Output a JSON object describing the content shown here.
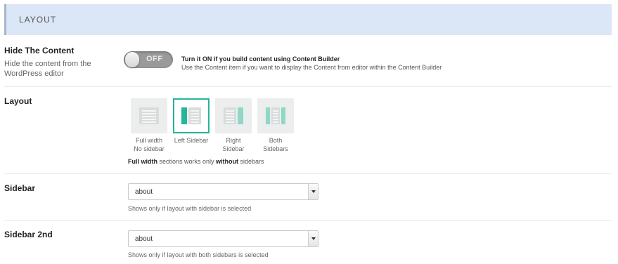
{
  "section": {
    "title": "LAYOUT"
  },
  "hide_content": {
    "title": "Hide The Content",
    "description": "Hide the content from the WordPress editor",
    "toggle_state": "OFF",
    "hint_title": "Turn it ON if you build content using Content Builder",
    "hint_sub": "Use the Content item if you want to display the Content from editor within the Content Builder"
  },
  "layout": {
    "title": "Layout",
    "options": [
      {
        "label": "Full width No sidebar",
        "icon": "full-width-icon",
        "selected": false
      },
      {
        "label": "Left Sidebar",
        "icon": "left-sidebar-icon",
        "selected": true
      },
      {
        "label": "Right Sidebar",
        "icon": "right-sidebar-icon",
        "selected": false
      },
      {
        "label": "Both Sidebars",
        "icon": "both-sidebars-icon",
        "selected": false
      }
    ],
    "note_bold1": "Full width",
    "note_mid": " sections works only ",
    "note_bold2": "without",
    "note_end": " sidebars"
  },
  "sidebar": {
    "title": "Sidebar",
    "value": "about",
    "note": "Shows only if layout with sidebar is selected"
  },
  "sidebar2": {
    "title": "Sidebar 2nd",
    "value": "about",
    "note": "Shows only if layout with both sidebars is selected"
  },
  "colors": {
    "accent": "#25b59a",
    "accent_light": "#8fd8c8",
    "header_bg": "#dbe6f6"
  }
}
